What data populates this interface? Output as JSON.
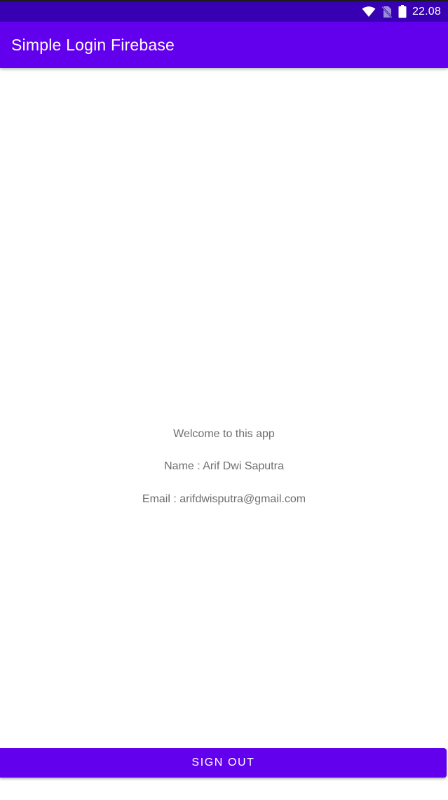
{
  "status_bar": {
    "time": "22.08",
    "icons": [
      "wifi-icon",
      "no-sim-icon",
      "battery-icon"
    ]
  },
  "app_bar": {
    "title": "Simple Login Firebase"
  },
  "main": {
    "welcome_text": "Welcome to this app",
    "name_text": "Name : Arif Dwi Saputra",
    "email_text": "Email : arifdwisputra@gmail.com"
  },
  "actions": {
    "sign_out_label": "Sign Out"
  },
  "colors": {
    "status_bar": "#3700b3",
    "primary": "#6200ee",
    "text_secondary": "#6e6e6e",
    "background": "#ffffff"
  }
}
